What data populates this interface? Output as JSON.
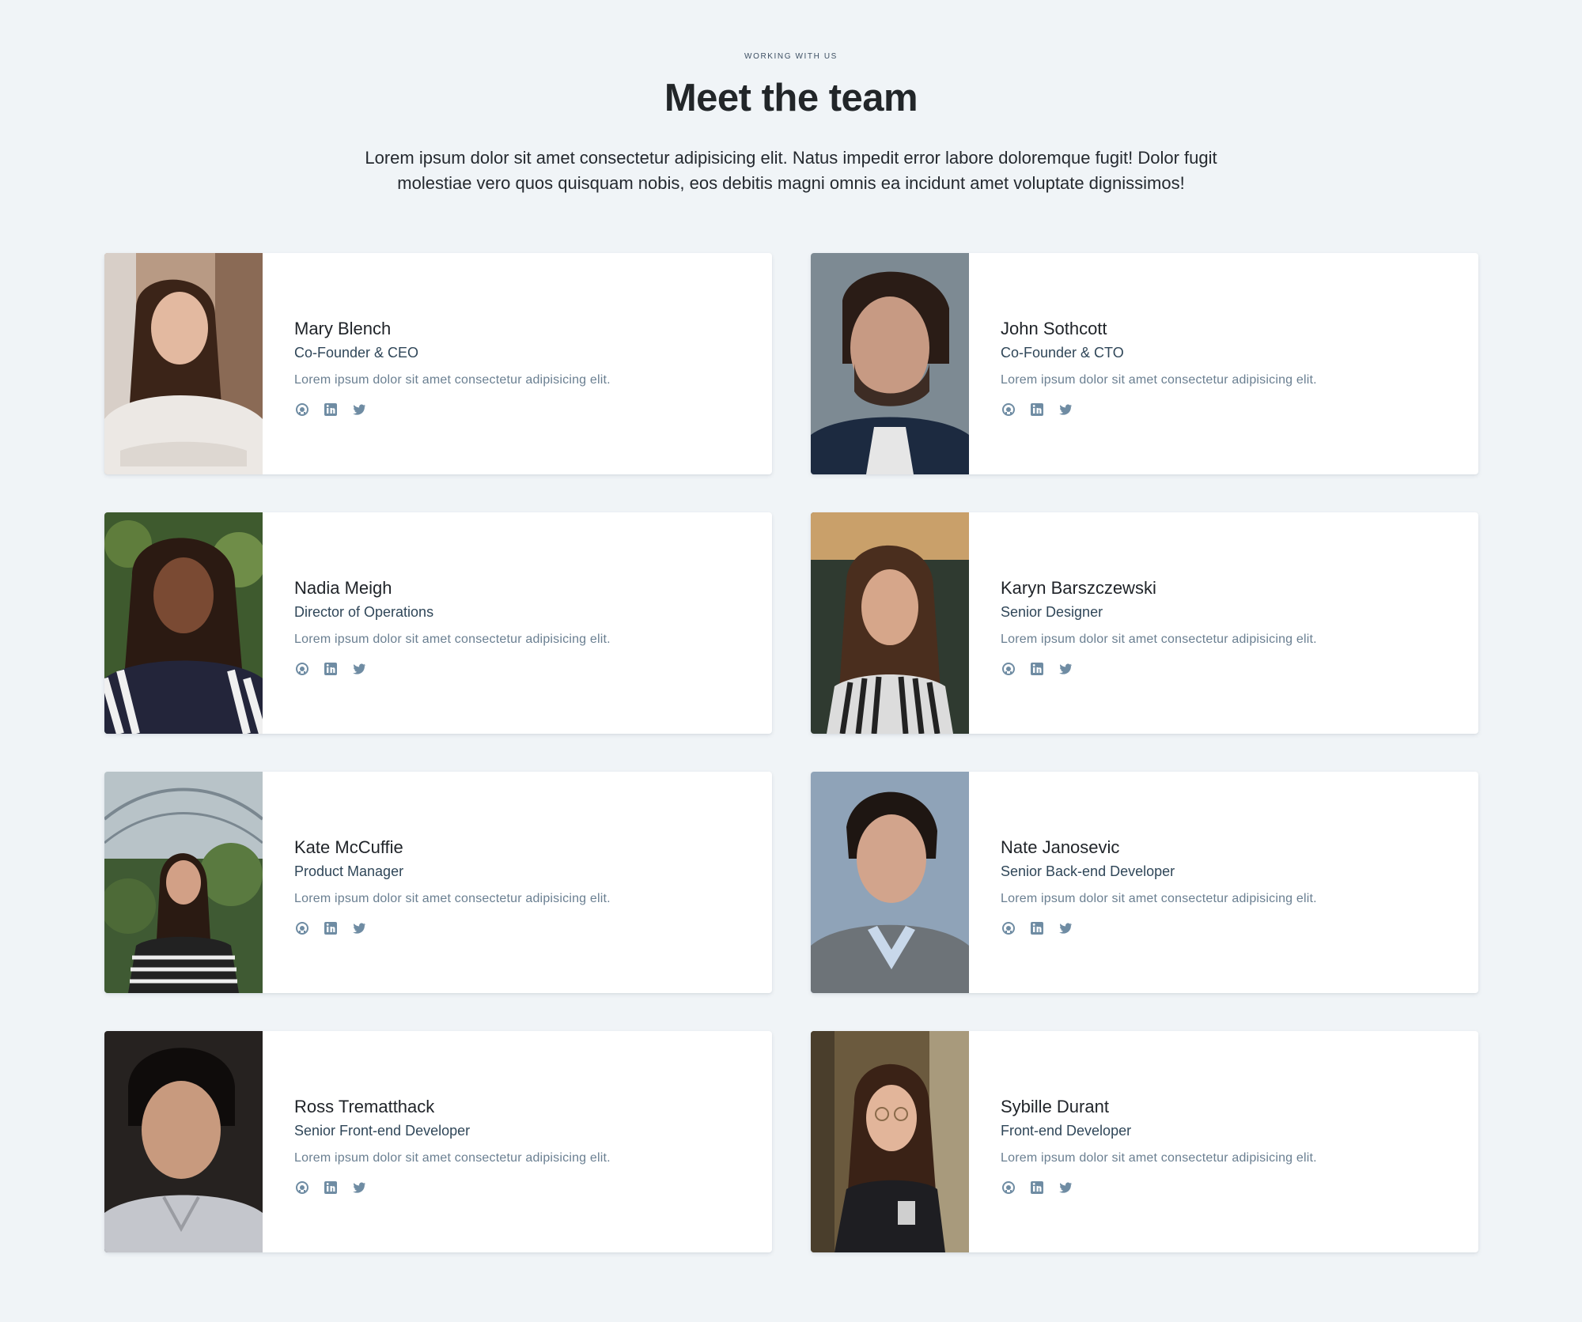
{
  "header": {
    "eyebrow": "WORKING WITH US",
    "title": "Meet the team",
    "intro": "Lorem ipsum dolor sit amet consectetur adipisicing elit. Natus impedit error labore doloremque fugit! Dolor fugit molestiae vero quos quisquam nobis, eos debitis magni omnis ea incidunt amet voluptate dignissimos!"
  },
  "team": [
    {
      "name": "Mary Blench",
      "role": "Co-Founder & CEO",
      "bio": "Lorem ipsum dolor sit amet consectetur adipisicing elit."
    },
    {
      "name": "John Sothcott",
      "role": "Co-Founder & CTO",
      "bio": "Lorem ipsum dolor sit amet consectetur adipisicing elit."
    },
    {
      "name": "Nadia Meigh",
      "role": "Director of Operations",
      "bio": "Lorem ipsum dolor sit amet consectetur adipisicing elit."
    },
    {
      "name": "Karyn Barszczewski",
      "role": "Senior Designer",
      "bio": "Lorem ipsum dolor sit amet consectetur adipisicing elit."
    },
    {
      "name": "Kate McCuffie",
      "role": "Product Manager",
      "bio": "Lorem ipsum dolor sit amet consectetur adipisicing elit."
    },
    {
      "name": "Nate Janosevic",
      "role": "Senior Back-end Developer",
      "bio": "Lorem ipsum dolor sit amet consectetur adipisicing elit."
    },
    {
      "name": "Ross Trematthack",
      "role": "Senior Front-end Developer",
      "bio": "Lorem ipsum dolor sit amet consectetur adipisicing elit."
    },
    {
      "name": "Sybille Durant",
      "role": "Front-end Developer",
      "bio": "Lorem ipsum dolor sit amet consectetur adipisicing elit."
    }
  ],
  "social_icons": [
    "github-icon",
    "linkedin-icon",
    "twitter-icon"
  ],
  "colors": {
    "background": "#f0f4f7",
    "card": "#ffffff",
    "icon": "#6f8ca3",
    "role_text": "#2f4658",
    "bio_text": "#6a7f91"
  }
}
